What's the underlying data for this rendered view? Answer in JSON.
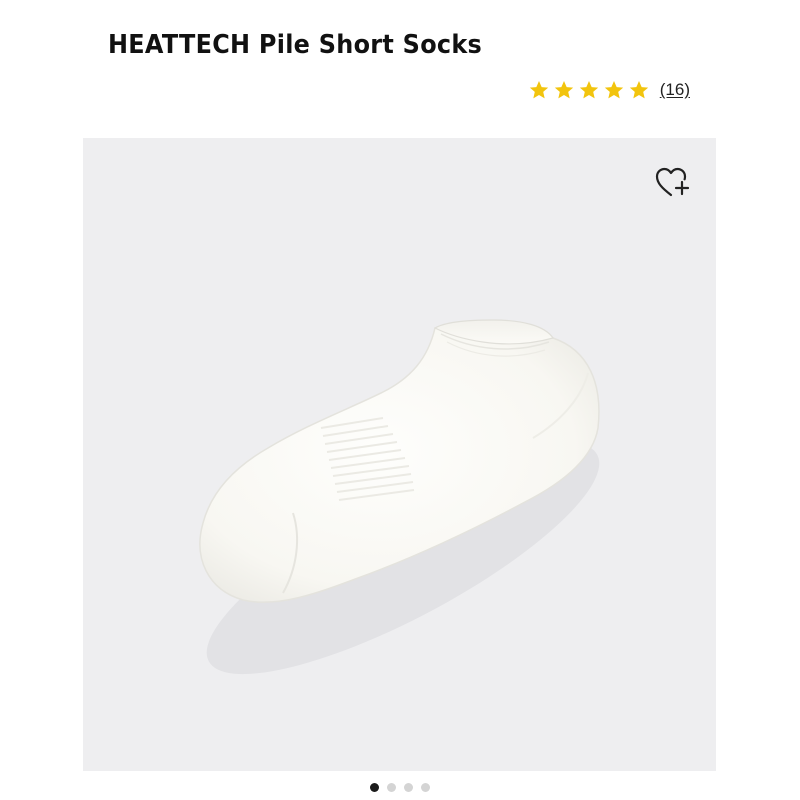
{
  "product": {
    "title": "HEATTECH Pile Short Socks",
    "rating": {
      "stars": 5,
      "review_count": "(16)",
      "star_color": "#f2c40d"
    }
  },
  "gallery": {
    "background_color": "#eeeef0",
    "image": "white-ankle-sock",
    "wishlist_icon": "heart-plus-icon",
    "total_images": 4,
    "active_index": 0
  }
}
